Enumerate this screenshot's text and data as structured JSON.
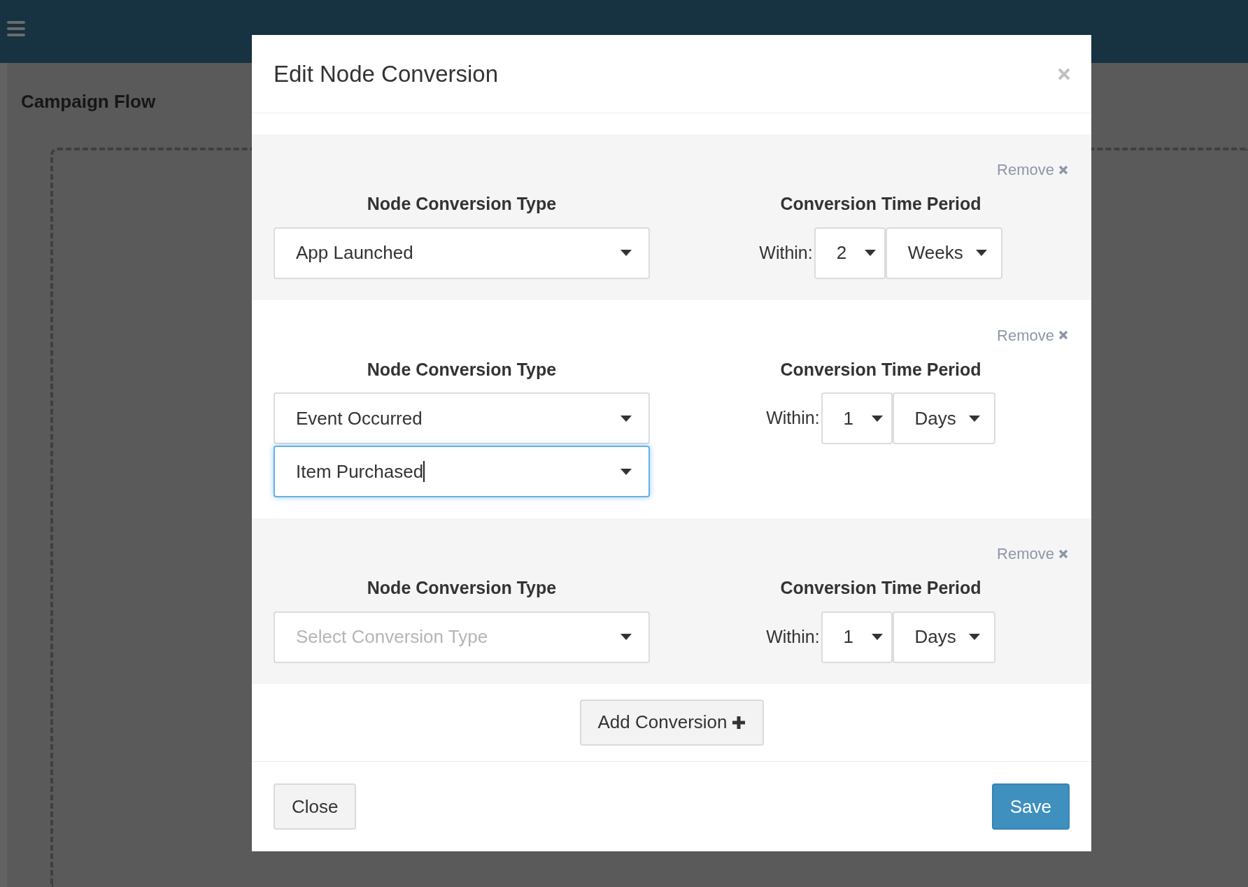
{
  "page": {
    "title": "Campaign Flow"
  },
  "modal": {
    "title": "Edit Node Conversion",
    "conversions": [
      {
        "remove": "Remove",
        "type_label": "Node Conversion Type",
        "type_selects": [
          {
            "value": "App Launched",
            "focused": false
          }
        ],
        "period_label": "Conversion Time Period",
        "within_label": "Within:",
        "amount": "2",
        "unit": "Weeks"
      },
      {
        "remove": "Remove",
        "type_label": "Node Conversion Type",
        "type_selects": [
          {
            "value": "Event Occurred",
            "focused": false
          },
          {
            "value": "Item Purchased",
            "focused": true
          }
        ],
        "period_label": "Conversion Time Period",
        "within_label": "Within:",
        "amount": "1",
        "unit": "Days"
      },
      {
        "remove": "Remove",
        "type_label": "Node Conversion Type",
        "type_selects": [
          {
            "placeholder": "Select Conversion Type",
            "focused": false
          }
        ],
        "period_label": "Conversion Time Period",
        "within_label": "Within:",
        "amount": "1",
        "unit": "Days"
      }
    ],
    "add_button": "Add Conversion",
    "close_button": "Close",
    "save_button": "Save"
  }
}
